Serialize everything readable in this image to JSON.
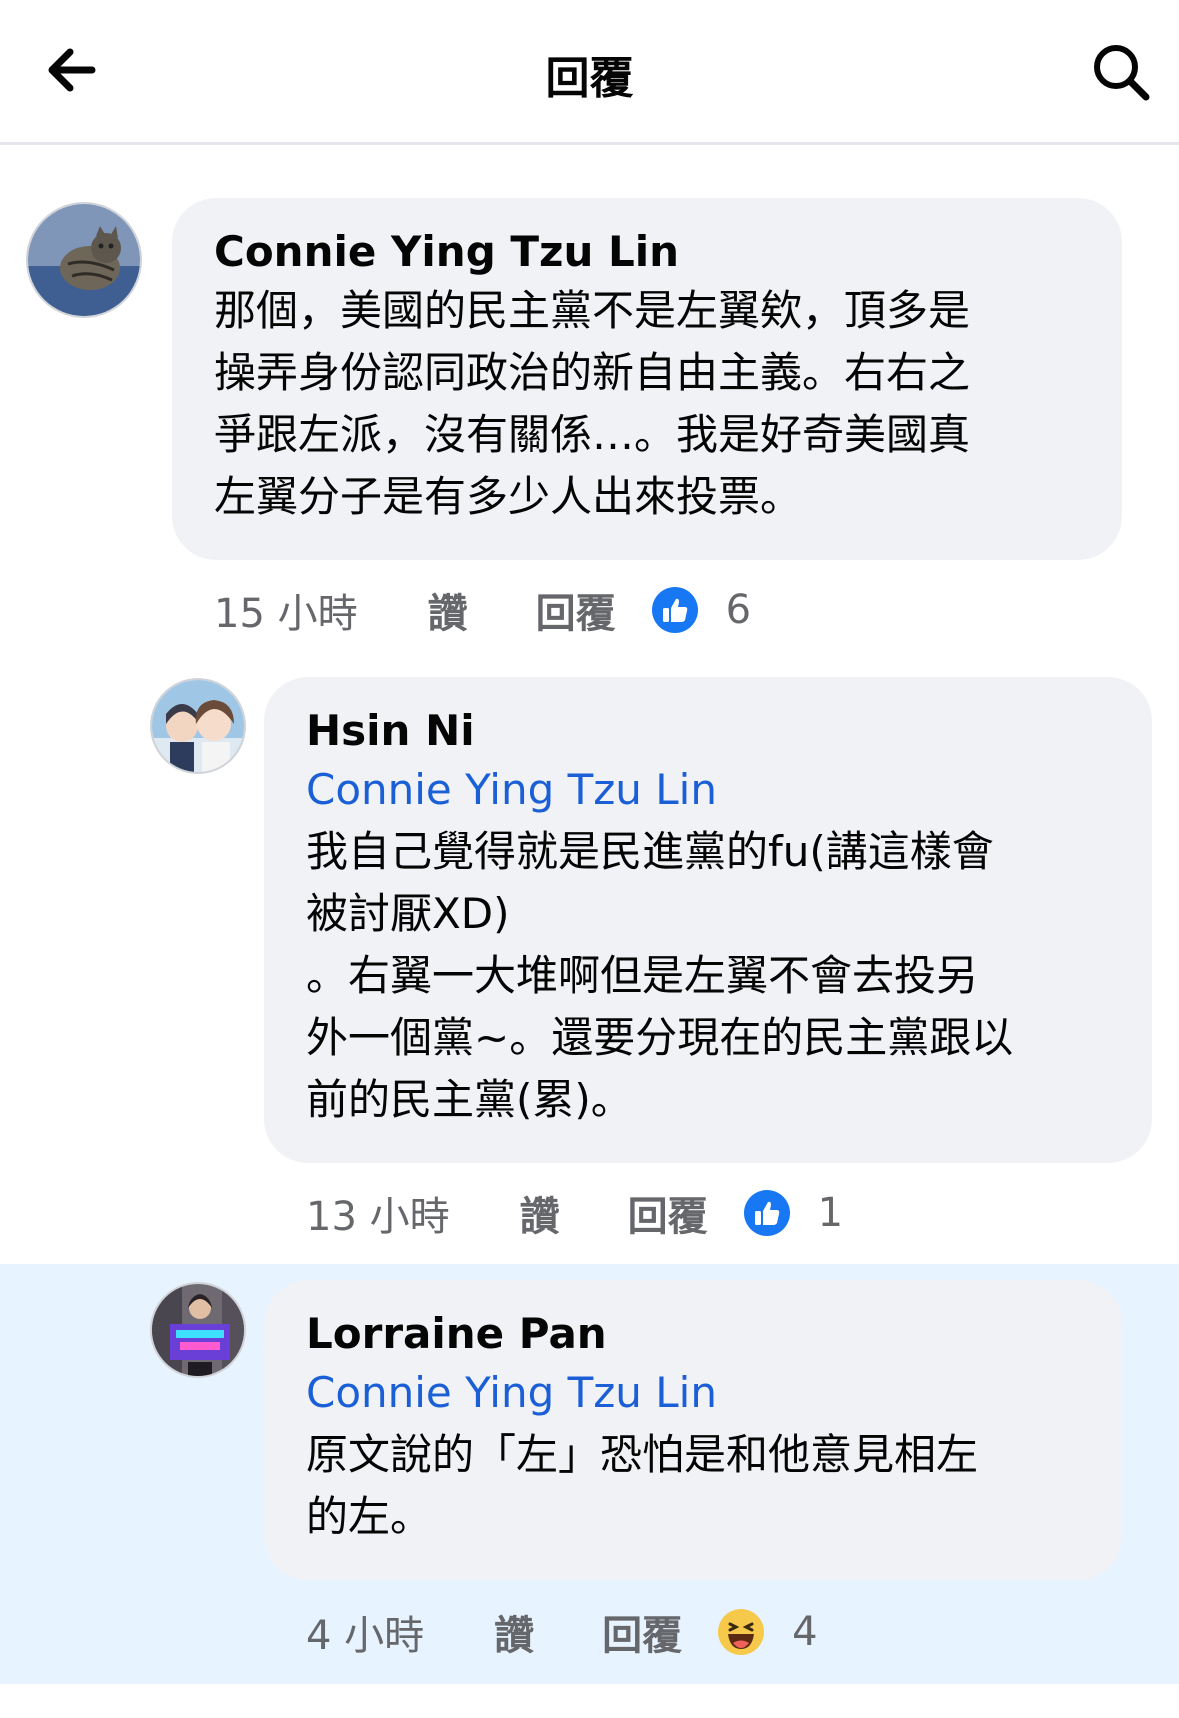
{
  "header": {
    "title": "回覆",
    "back_icon": "arrow-left-icon",
    "search_icon": "search-icon"
  },
  "colors": {
    "mention": "#1b5fd6",
    "like_blue": "#1877f2",
    "highlight": "#e7f3ff",
    "bubble": "#f0f2f5"
  },
  "comments": [
    {
      "author": "Connie Ying Tzu Lin",
      "mention": "",
      "text": "那個，美國的民主黨不是左翼欸，頂多是\n操弄身份認同政治的新自由主義。右右之\n爭跟左派，沒有關係…。我是好奇美國真\n左翼分子是有多少人出來投票。",
      "time": "15 小時",
      "like_label": "讚",
      "reply_label": "回覆",
      "reaction_icon": "thumbs-up-icon",
      "reaction_count": "6"
    },
    {
      "author": "Hsin Ni",
      "mention": "Connie Ying Tzu Lin",
      "text": "我自己覺得就是民進黨的fu(講這樣會\n被討厭XD)\n。右翼一大堆啊但是左翼不會去投另\n外一個黨~。還要分現在的民主黨跟以\n前的民主黨(累)。",
      "time": "13 小時",
      "like_label": "讚",
      "reply_label": "回覆",
      "reaction_icon": "thumbs-up-icon",
      "reaction_count": "1"
    },
    {
      "author": "Lorraine Pan",
      "mention": "Connie Ying Tzu Lin",
      "text": "原文說的「左」恐怕是和他意見相左\n的左。",
      "time": "4 小時",
      "like_label": "讚",
      "reply_label": "回覆",
      "reaction_icon": "haha-emoji-icon",
      "reaction_count": "4"
    }
  ]
}
